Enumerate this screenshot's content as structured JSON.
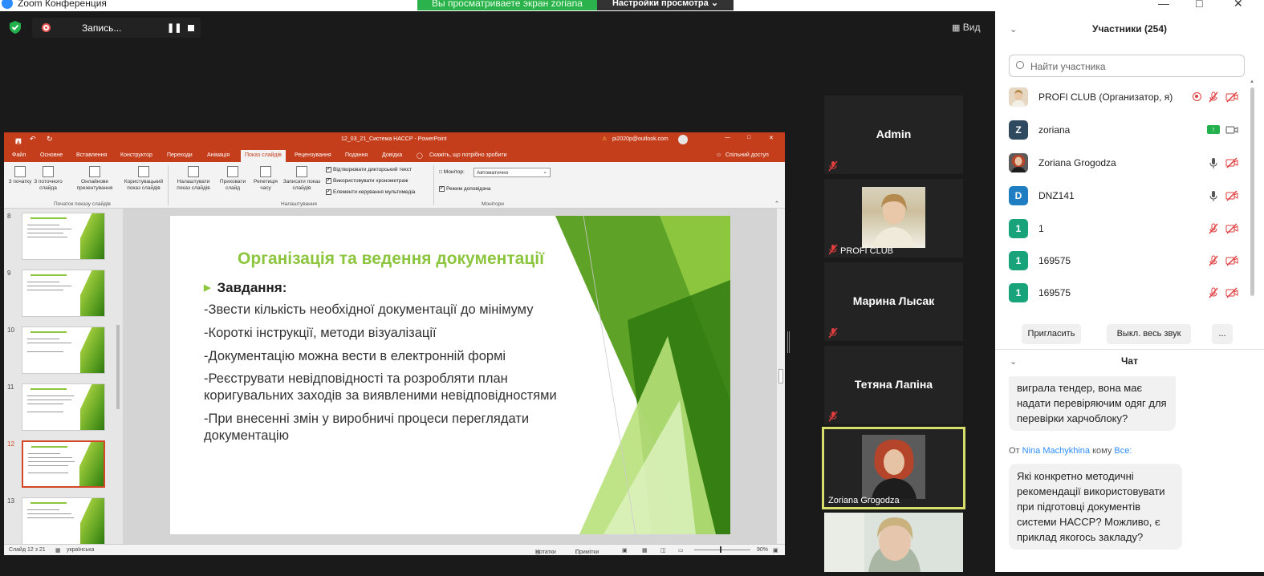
{
  "window": {
    "title": "Zoom Конференция"
  },
  "banner": {
    "text": "Вы просматриваете экран zoriana",
    "settings": "Настройки просмотра"
  },
  "recording": {
    "label": "Запись..."
  },
  "view_button": "Вид",
  "ppt": {
    "title": "12_03_21_Система НАССР - PowerPoint",
    "account": "pi2020p@outlook.com",
    "tabs": [
      "Файл",
      "Основне",
      "Вставлення",
      "Конструктор",
      "Переходи",
      "Анімація",
      "Показ слайдів",
      "Рецензування",
      "Подання",
      "Довідка"
    ],
    "tell": "Скажіть, що потрібно зробити",
    "share": "Спільний доступ",
    "ribbon": {
      "b1": "З початку",
      "b2": "З поточного слайда",
      "b3": "Онлайнове презентування",
      "b4": "Користувацький показ слайдів",
      "g1": "Початок показу слайдів",
      "b5": "Налаштувати показ слайдів",
      "b6": "Приховати слайд",
      "b7": "Репетиція часу",
      "b8": "Записати показ слайдів",
      "c1": "Відтворювати дикторський текст",
      "c2": "Використовувати хронометраж",
      "c3": "Елементи керування мультимедіа",
      "g2": "Налаштування",
      "monitor_label": "Монітор:",
      "monitor_value": "Автоматично",
      "presenter": "Режим доповідача",
      "g3": "Монітори"
    },
    "thumb_numbers": [
      "8",
      "9",
      "10",
      "11",
      "12",
      "13"
    ],
    "slide": {
      "title": "Організація та ведення документації",
      "heading": "Завдання:",
      "lines": [
        "-Звести кількість необхідної документації до мінімуму",
        "-Короткі інструкції, методи візуалізації",
        "-Документацію можна вести в електронній формі",
        "-Реєструвати невідповідності та розробляти план коригувальних заходів за виявленими невідповідностями",
        "-При внесенні змін у виробничі процеси переглядати документацію"
      ]
    },
    "status": {
      "slide": "Слайд 12 з 21",
      "lang": "українська",
      "notes": "Нотатки",
      "comments": "Примітки",
      "zoom": "90%"
    }
  },
  "tiles": [
    {
      "name": "Admin"
    },
    {
      "label": "PROFI CLUB"
    },
    {
      "name": "Марина Лысак"
    },
    {
      "name": "Тетяна Лапіна"
    },
    {
      "label": "Zoriana Grogodza"
    }
  ],
  "participants": {
    "header": "Участники (254)",
    "search_placeholder": "Найти участника",
    "list": [
      {
        "avatar": "",
        "name": "PROFI CLUB (Организатор, я)",
        "color": "#c9b99a"
      },
      {
        "avatar": "Z",
        "name": "zoriana",
        "color": "#2f4a5f"
      },
      {
        "avatar": "",
        "name": "Zoriana Grogodza",
        "color": "#8a4a2a"
      },
      {
        "avatar": "D",
        "name": "DNZ141",
        "color": "#1f7dc2"
      },
      {
        "avatar": "1",
        "name": "1",
        "color": "#18a37a"
      },
      {
        "avatar": "1",
        "name": "169575",
        "color": "#18a37a"
      },
      {
        "avatar": "1",
        "name": "169575",
        "color": "#18a37a"
      }
    ],
    "invite": "Пригласить",
    "mute_all": "Выкл. весь звук",
    "more": "..."
  },
  "chat": {
    "header": "Чат",
    "msg1": "виграла тендер, вона має надати перевіряючим одяг для перевірки харчоблоку?",
    "from_label": "От",
    "from_name": "Nina Machykhina",
    "to_label": "кому",
    "to_name": "Все:",
    "msg2": "Які конкретно методичні рекомендації використовувати при підготовці документів системи НАССР? Можливо, є приклад якогось закладу?"
  }
}
